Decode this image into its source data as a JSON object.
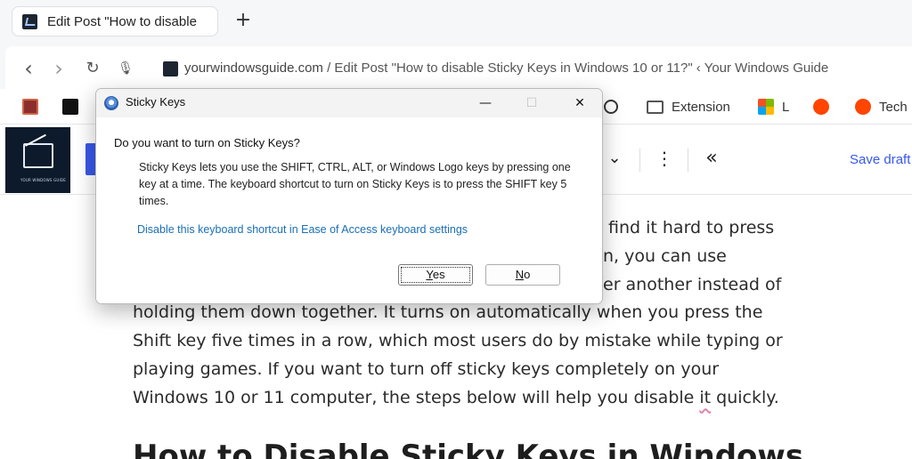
{
  "browser": {
    "tab": {
      "title": "Edit Post \"How to disable",
      "new_tab_glyph": "+"
    },
    "nav": {
      "back_glyph": "‹",
      "forward_glyph": "›",
      "reload_glyph": "↻",
      "mic_glyph": "🎙"
    },
    "address": {
      "host": "yourwindowsguide.com",
      "rest": " / Edit Post \"How to disable Sticky Keys in Windows 10 or 11?\" ‹ Your Windows Guide"
    },
    "bookmarks": [
      {
        "label": "",
        "icon": "rssb-icon",
        "color": "#8c2d2d"
      },
      {
        "label": "",
        "icon": "wa-logo-icon",
        "color": "#111111"
      },
      {
        "label": "",
        "icon": "openai-icon",
        "color": "#333333"
      },
      {
        "label": "Extension",
        "icon": "folder-icon",
        "color": "#555555"
      },
      {
        "label": "L",
        "icon": "microsoft-icon",
        "color": "#f25022"
      },
      {
        "label": "",
        "icon": "reddit-icon",
        "color": "#ff4500"
      },
      {
        "label": "Tech",
        "icon": "reddit-icon",
        "color": "#ff4500"
      }
    ]
  },
  "editor": {
    "logo_caption": "YOUR WINDOWS GUIDE",
    "chevron_glyph": "⌄",
    "more_glyph": "⋮",
    "collapse_glyph": "«",
    "save_draft": "Save draft",
    "accent_color": "#3858e9"
  },
  "article": {
    "lines": [
      "find it hard to press",
      "n, you can use",
      "er another instead of",
      "holding them down together. It turns on automatically when you press the",
      "Shift key five times in a row, which most users do by mistake while typing or",
      "playing games. If you want to turn off sticky keys completely on your"
    ],
    "last_line_before": "Windows 10 or 11 computer, the steps below will help you disable ",
    "last_line_marked": "it",
    "last_line_after": " quickly.",
    "heading": "How to Disable Sticky Keys in Windows"
  },
  "dialog": {
    "title": "Sticky Keys",
    "minimize_glyph": "—",
    "maximize_glyph": "☐",
    "close_glyph": "✕",
    "question": "Do you want to turn on Sticky Keys?",
    "description": "Sticky Keys lets you use the SHIFT, CTRL, ALT, or Windows Logo keys by pressing one key at a time. The keyboard shortcut to turn on Sticky Keys is to press the SHIFT key 5 times.",
    "link": "Disable this keyboard shortcut in Ease of Access keyboard settings",
    "yes_accel": "Y",
    "yes_rest": "es",
    "no_accel": "N",
    "no_rest": "o"
  }
}
